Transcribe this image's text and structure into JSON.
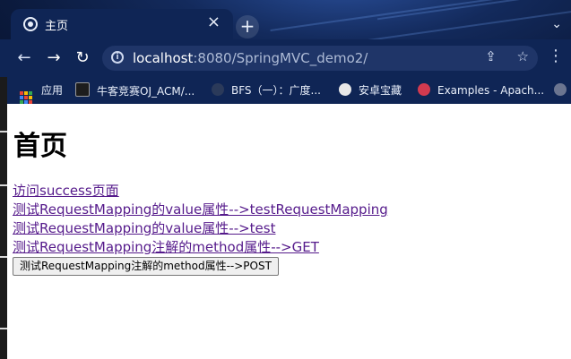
{
  "browser": {
    "tab": {
      "title": "主页",
      "close": "×"
    },
    "new_tab": "+",
    "tab_list": "⌄",
    "toolbar": {
      "back": "←",
      "forward": "→",
      "reload": "↻",
      "url_host": "localhost",
      "url_rest": ":8080/SpringMVC_demo2/",
      "share": "⇪",
      "star": "☆",
      "menu": "⋮"
    },
    "bookmarks": [
      {
        "label": "应用",
        "icon": "apps-grid-icon"
      },
      {
        "label": "牛客竞赛OJ_ACM/...",
        "icon": "nowcoder-icon"
      },
      {
        "label": "BFS（一）：广度...",
        "icon": "bookmark-icon"
      },
      {
        "label": "安卓宝藏",
        "icon": "github-icon"
      },
      {
        "label": "Examples - Apach...",
        "icon": "examples-icon"
      }
    ]
  },
  "page": {
    "title": "首页",
    "links": [
      "访问success页面",
      "测试RequestMapping的value属性-->testRequestMapping",
      "测试RequestMapping的value属性-->test",
      "测试RequestMapping注解的method属性-->GET"
    ],
    "post_button": "测试RequestMapping注解的method属性-->POST"
  }
}
